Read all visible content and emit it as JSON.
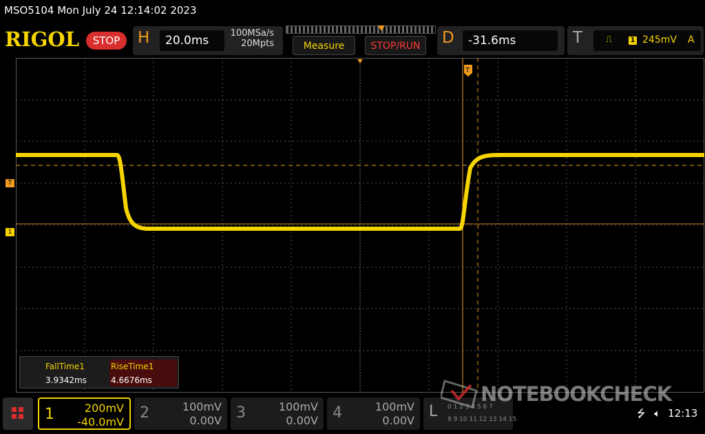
{
  "header": {
    "title": "MSO5104  Mon July 24 12:14:02 2023",
    "brand": "RIGOL",
    "run_state": "STOP"
  },
  "horizontal": {
    "letter": "H",
    "timebase": "20.0ms",
    "sample_rate": "100MSa/s",
    "memory_depth": "20Mpts"
  },
  "toolbar": {
    "measure_label": "Measure",
    "stoprun_label": "STOP/RUN"
  },
  "delay": {
    "letter": "D",
    "value": "-31.6ms"
  },
  "trigger": {
    "letter": "T",
    "source": "1",
    "level": "245mV",
    "mode": "A",
    "marker_label": "T"
  },
  "ch1_marker": "1",
  "measurements": {
    "items": [
      {
        "name": "FallTime1",
        "value": "3.9342ms"
      },
      {
        "name": "RiseTime1",
        "value": "4.6676ms"
      }
    ]
  },
  "channels": [
    {
      "num": "1",
      "scale": "200mV",
      "offset": "-40.0mV",
      "color": "#f5d400",
      "active": true
    },
    {
      "num": "2",
      "scale": "100mV",
      "offset": "0.00V",
      "color": "#888888",
      "active": false
    },
    {
      "num": "3",
      "scale": "100mV",
      "offset": "0.00V",
      "color": "#888888",
      "active": false
    },
    {
      "num": "4",
      "scale": "100mV",
      "offset": "0.00V",
      "color": "#888888",
      "active": false
    }
  ],
  "logic": {
    "label": "L",
    "row1": "0 1 2 3 4 5 6 7",
    "row2": "8 9 10 11 12 13 14 15"
  },
  "watermark": "NOTEBOOKCHECK",
  "status": {
    "time": "12:13"
  },
  "colors": {
    "trace": "#f5d400",
    "trigger": "#f29a1f",
    "accent_red": "#d82e2e",
    "grid": "#5a5a5a"
  }
}
